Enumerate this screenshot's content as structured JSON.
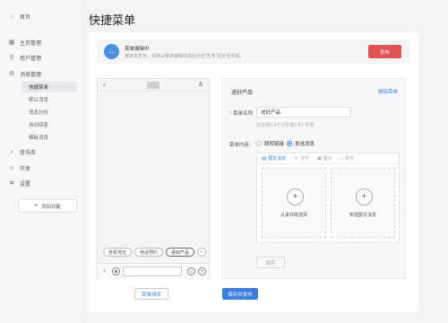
{
  "sidebar": {
    "items": [
      {
        "label": "首页",
        "icon": "home-icon"
      },
      {
        "label": "主页管理",
        "icon": "grid-icon"
      },
      {
        "label": "用户管理",
        "icon": "user-icon"
      },
      {
        "label": "消息管理",
        "icon": "settings-icon"
      },
      {
        "label": "音乐库",
        "icon": "music-icon"
      },
      {
        "label": "开发",
        "icon": "code-icon"
      },
      {
        "label": "设置",
        "icon": "gear-icon"
      }
    ],
    "sub_items": [
      "快捷菜单",
      "默认消息",
      "消息分析",
      "自动回复",
      "模板消息"
    ],
    "add_feature": "添加功能"
  },
  "page_title": "快捷菜单",
  "notice": {
    "title": "菜单编辑中",
    "desc": "菜单未发布，请确认菜单编辑完成后点击“发布”同步至手机。",
    "publish": "发布",
    "bubble_text": "···"
  },
  "phone": {
    "back": "‹",
    "menu_tabs": [
      "查看地址",
      "电话预约",
      "进好产品"
    ],
    "add_tab": "+"
  },
  "panel": {
    "name_header": "进好产品",
    "delete_label": "删除菜单",
    "name_label": "菜单名称",
    "name_value": "进好产品",
    "hint": "仅支持1-4个汉字或1-8个字母",
    "content_label": "菜单内容",
    "options": [
      "跳转链接",
      "发送消息"
    ],
    "selected_option": "发送消息",
    "tabs": [
      "图文消息",
      "文字",
      "图片",
      "语音"
    ],
    "active_tab": "图文消息",
    "choice_from_library": "从素材库选择",
    "choice_new": "新建图文消息",
    "save": "保存"
  },
  "footer": {
    "sort": "菜单排序",
    "save_publish": "保存并发布"
  },
  "colors": {
    "accent": "#3d7de0",
    "publish_red": "#e05454",
    "bubble_blue": "#4a90e2"
  }
}
